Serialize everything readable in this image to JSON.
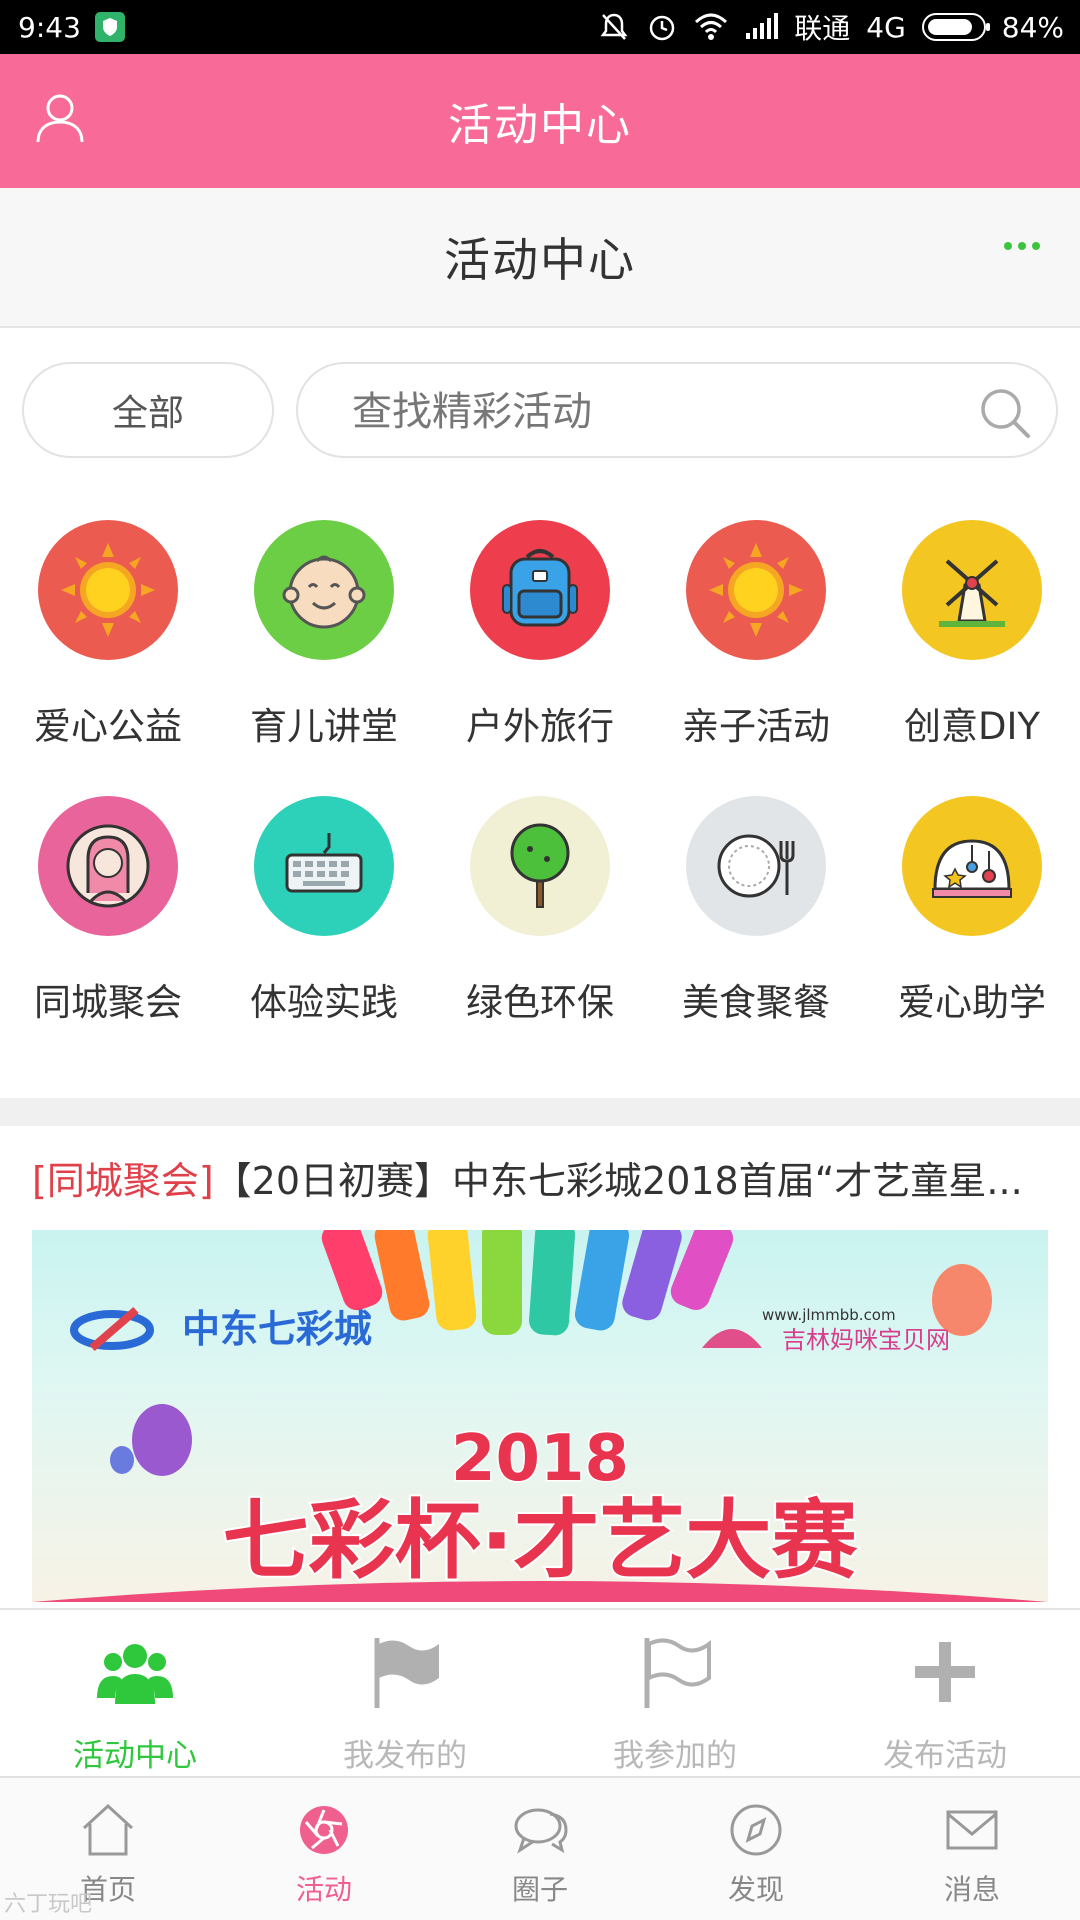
{
  "status": {
    "time": "9:43",
    "carrier": "联通",
    "network": "4G",
    "battery": "84%",
    "battery_level": 0.84
  },
  "header": {
    "title": "活动中心"
  },
  "subheader": {
    "title": "活动中心"
  },
  "search": {
    "filter_label": "全部",
    "placeholder": "查找精彩活动"
  },
  "categories": [
    {
      "label": "爱心公益",
      "icon": "sun-icon",
      "color": "#ec5b4f"
    },
    {
      "label": "育儿讲堂",
      "icon": "baby-face-icon",
      "color": "#6cce45"
    },
    {
      "label": "户外旅行",
      "icon": "backpack-icon",
      "color": "#ee3e4e"
    },
    {
      "label": "亲子活动",
      "icon": "sun-icon",
      "color": "#ec5b4f"
    },
    {
      "label": "创意DIY",
      "icon": "windmill-icon",
      "color": "#f3c622"
    },
    {
      "label": "同城聚会",
      "icon": "woman-avatar-icon",
      "color": "#e8649a"
    },
    {
      "label": "体验实践",
      "icon": "keyboard-icon",
      "color": "#2dd0b8"
    },
    {
      "label": "绿色环保",
      "icon": "tree-icon",
      "color": "#f1efd4"
    },
    {
      "label": "美食聚餐",
      "icon": "plate-fork-icon",
      "color": "#e1e5e8"
    },
    {
      "label": "爱心助学",
      "icon": "planetarium-icon",
      "color": "#f3c622"
    }
  ],
  "feed": {
    "tag": "[同城聚会]",
    "title": "【20日初赛】中东七彩城2018首届“才艺童星...",
    "banner": {
      "brand_left": "中东七彩城",
      "url": "www.jlmmbb.com",
      "brand_right": "吉林妈咪宝贝网",
      "year": "2018",
      "headline": "七彩杯·才艺大赛"
    }
  },
  "subtabs": [
    {
      "label": "活动中心",
      "icon": "people-group-icon",
      "active": true
    },
    {
      "label": "我发布的",
      "icon": "flag-filled-icon",
      "active": false
    },
    {
      "label": "我参加的",
      "icon": "flag-outline-icon",
      "active": false
    },
    {
      "label": "发布活动",
      "icon": "plus-icon",
      "active": false
    }
  ],
  "nav": [
    {
      "label": "首页",
      "icon": "home-icon",
      "active": false
    },
    {
      "label": "活动",
      "icon": "camera-shutter-icon",
      "active": true
    },
    {
      "label": "圈子",
      "icon": "chat-bubbles-icon",
      "active": false
    },
    {
      "label": "发现",
      "icon": "compass-icon",
      "active": false
    },
    {
      "label": "消息",
      "icon": "envelope-icon",
      "active": false
    }
  ],
  "colors": {
    "header": "#f86b99",
    "active_green": "#2fc83d",
    "active_pink": "#f0608f",
    "tag_red": "#e0404a"
  },
  "watermark": "六丁玩吧"
}
